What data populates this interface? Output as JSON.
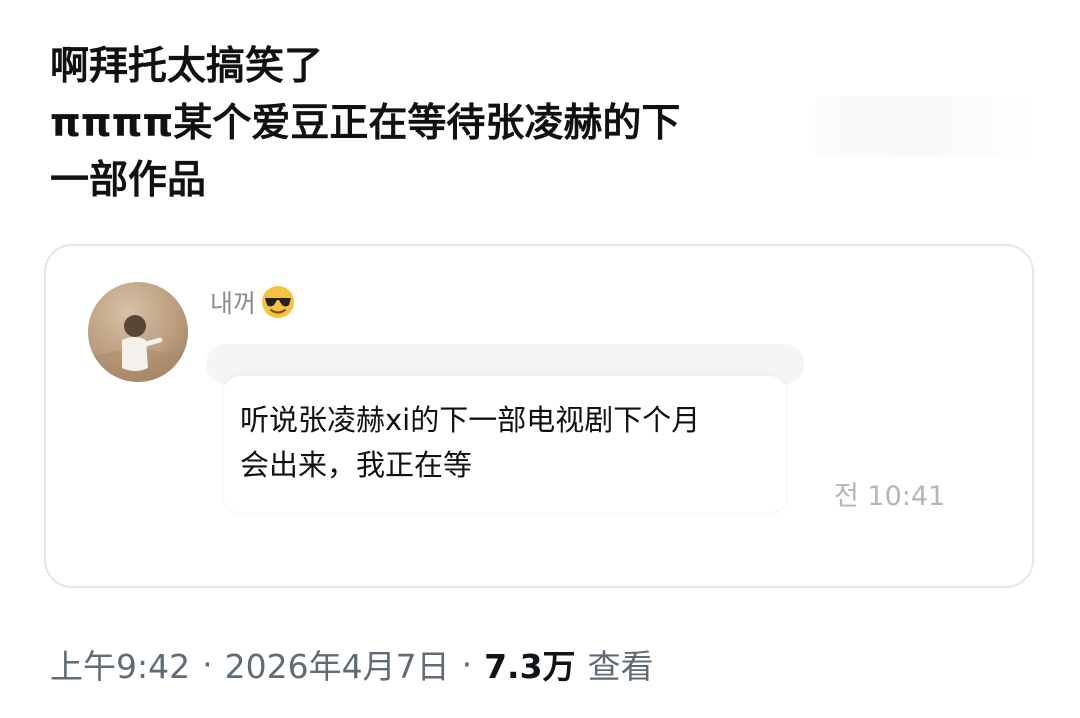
{
  "post": {
    "lines": [
      "啊拜托太搞笑了",
      "ππππ某个爱豆正在等待张凌赫的下",
      "一部作品"
    ]
  },
  "message": {
    "sender": "내꺼",
    "sender_emoji_icon": "sunglasses-face-icon",
    "text_lines": [
      "听说张凌赫xi的下一部电视剧下个月",
      "会出来，我正在等"
    ],
    "time": "전 10:41"
  },
  "meta": {
    "time": "上午9:42",
    "separator": "·",
    "date": "2026年4月7日",
    "views": "7.3万",
    "views_label": "查看"
  },
  "colors": {
    "text": "#0f1419",
    "secondary": "#5f6b75",
    "card_border": "#e4e6e8",
    "emoji_yellow": "#f6c13f"
  }
}
